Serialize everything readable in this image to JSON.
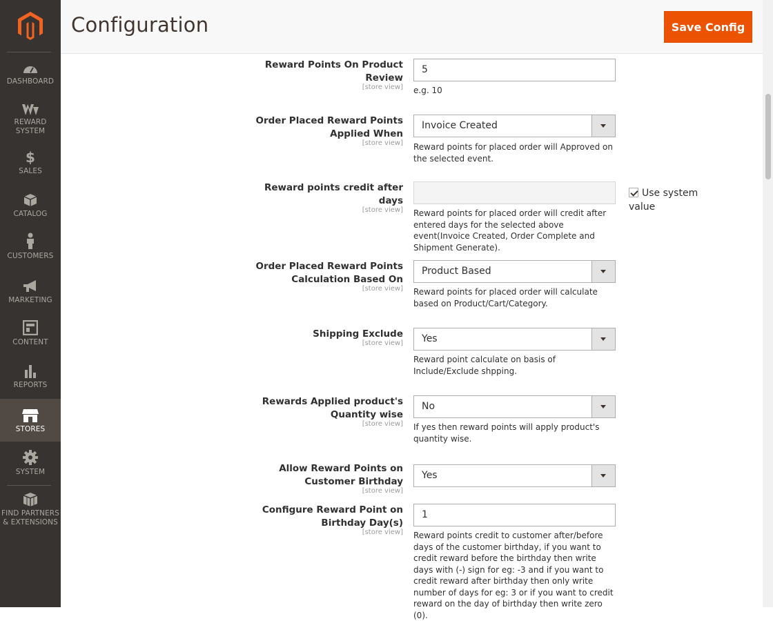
{
  "header": {
    "title": "Configuration",
    "save_label": "Save Config"
  },
  "sidebar": {
    "items": [
      {
        "id": "dashboard",
        "label": "DASHBOARD",
        "icon": "dashboard-icon"
      },
      {
        "id": "reward",
        "label": "REWARD SYSTEM",
        "icon": "reward-system-icon"
      },
      {
        "id": "sales",
        "label": "SALES",
        "icon": "dollar-icon"
      },
      {
        "id": "catalog",
        "label": "CATALOG",
        "icon": "box-icon"
      },
      {
        "id": "customers",
        "label": "CUSTOMERS",
        "icon": "person-icon"
      },
      {
        "id": "marketing",
        "label": "MARKETING",
        "icon": "megaphone-icon"
      },
      {
        "id": "content",
        "label": "CONTENT",
        "icon": "layout-icon"
      },
      {
        "id": "reports",
        "label": "REPORTS",
        "icon": "bar-chart-icon"
      },
      {
        "id": "stores",
        "label": "STORES",
        "icon": "storefront-icon",
        "active": true
      },
      {
        "id": "system",
        "label": "SYSTEM",
        "icon": "gear-icon"
      },
      {
        "id": "partners",
        "label": "FIND PARTNERS & EXTENSIONS",
        "icon": "blocks-icon"
      }
    ]
  },
  "scope_label": "[store view]",
  "fields": {
    "product_review": {
      "label": "Reward Points On Product Review",
      "value": "5",
      "note": "e.g. 10"
    },
    "order_applied": {
      "label": "Order Placed Reward Points Applied When",
      "value": "Invoice Created",
      "note": "Reward points for placed order will Approved on the selected event."
    },
    "credit_days": {
      "label": "Reward points credit after days",
      "value": "",
      "note": "Reward points for placed order will credit after entered days for the selected above event(Invoice Created, Order Complete and Shipment Generate).",
      "use_system_label": "Use system value",
      "use_system_checked": true
    },
    "calc_based": {
      "label": "Order Placed Reward Points Calculation Based On",
      "value": "Product Based",
      "note": "Reward points for placed order will calculate based on Product/Cart/Category."
    },
    "shipping_exclude": {
      "label": "Shipping Exclude",
      "value": "Yes",
      "note": "Reward point calculate on basis of Include/Exclude shpping."
    },
    "qty_wise": {
      "label": "Rewards Applied product's Quantity wise",
      "value": "No",
      "note": "If yes then reward points will apply product's quantity wise."
    },
    "birthday_allow": {
      "label": "Allow Reward Points on Customer Birthday",
      "value": "Yes"
    },
    "birthday_days": {
      "label": "Configure Reward Point on Birthday Day(s)",
      "value": "1",
      "note": "Reward points credit to customer after/before days of the customer birthday, if you want to credit reward before the birthday then write days with (-) sign for eg: -3 and if you want to credit reward after birthday then only write number of days for eg: 3 or if you want to credit reward on the day of birthday then write zero (0)."
    }
  },
  "colors": {
    "sidebar_bg": "#373330",
    "sidebar_active": "#514943",
    "accent": "#eb5202",
    "logo": "#f26322"
  }
}
